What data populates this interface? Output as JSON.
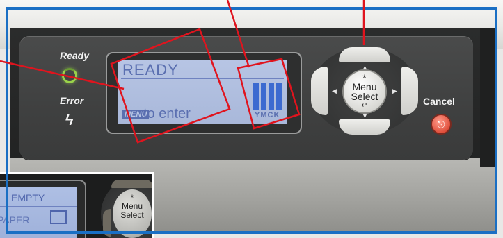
{
  "panel": {
    "ready_label": "Ready",
    "error_label": "Error",
    "cancel_label": "Cancel",
    "error_glyph": "ϟ",
    "cancel_glyph": "⎋"
  },
  "lcd": {
    "line1": "READY",
    "menu_key": "MENU",
    "line2": "to enter",
    "toner_letters": "YMCK",
    "toner_levels": [
      1.0,
      1.0,
      1.0,
      1.0
    ]
  },
  "menu_select": {
    "star": "*",
    "line1": "Menu",
    "line2": "Select",
    "enter": "↵",
    "arrows": [
      "▲",
      "▼",
      "◀",
      "▶"
    ]
  },
  "inset": {
    "line1": "EMPTY",
    "line2": "PAPER",
    "button_line1": "Menu",
    "button_line2": "Select",
    "star": "*"
  },
  "colors": {
    "frame": "#1a6fc4",
    "callout": "#e0141e",
    "lcd_text": "#5a6fb0",
    "ready_led": "#9ad24a",
    "cancel_button": "#e0503c"
  },
  "icons": [
    "ready-led-icon",
    "error-lightning-icon",
    "cancel-icon",
    "enter-icon",
    "arrow-icons"
  ]
}
